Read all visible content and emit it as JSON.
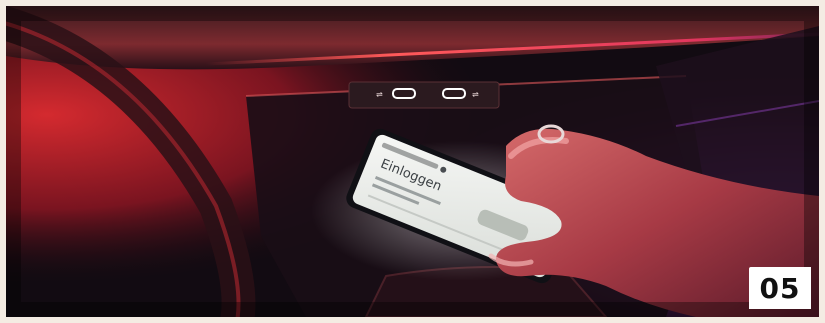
{
  "photo": {
    "subject": "hand placing smartphone on wireless charging pad in car center console at night",
    "palette": {
      "ambient_red": "#c1272d",
      "ambient_magenta": "#a21d5a",
      "console_dark": "#120d14",
      "screen_glow": "#eef0ee",
      "skin": "#b84a4a",
      "accent_purple": "#6b3fb0"
    },
    "phone_screen": {
      "heading": "Einloggen"
    }
  },
  "badge": {
    "number": "05"
  }
}
